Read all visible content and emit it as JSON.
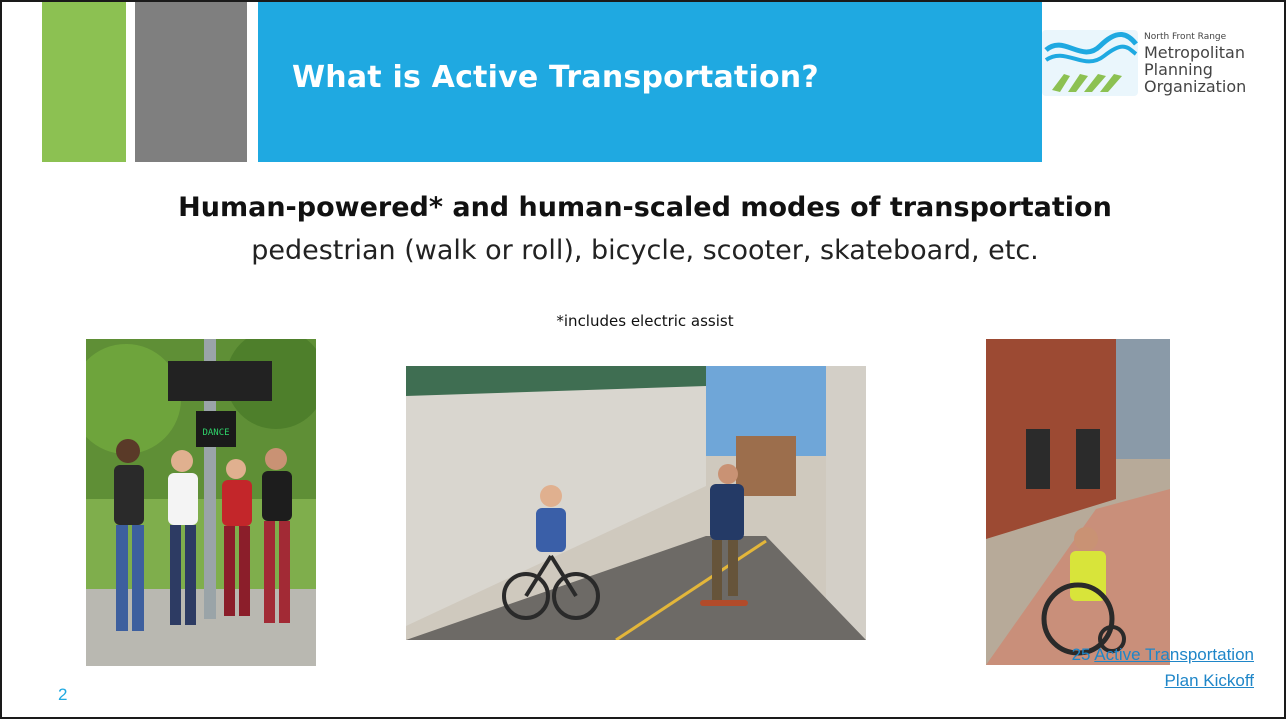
{
  "slide": {
    "title": "What is Active Transportation?",
    "heading": "Human-powered* and human-scaled modes of transportation",
    "subheading": "pedestrian (walk or roll), bicycle, scooter, skateboard, etc.",
    "note": "*includes electric assist",
    "page_number": "2",
    "footer_prefix": "25 ",
    "footer_link": "Active Transportation Plan Kickoff"
  },
  "logo": {
    "small_text": "North Front Range",
    "line1": "Metropolitan",
    "line2": "Planning",
    "line3": "Organization"
  },
  "images": {
    "photo1_sign": "DANCE"
  },
  "colors": {
    "title_band": "#1fa9e1",
    "accent_green": "#8cc152",
    "accent_gray": "#7f7f7f",
    "link": "#1f86c8"
  }
}
